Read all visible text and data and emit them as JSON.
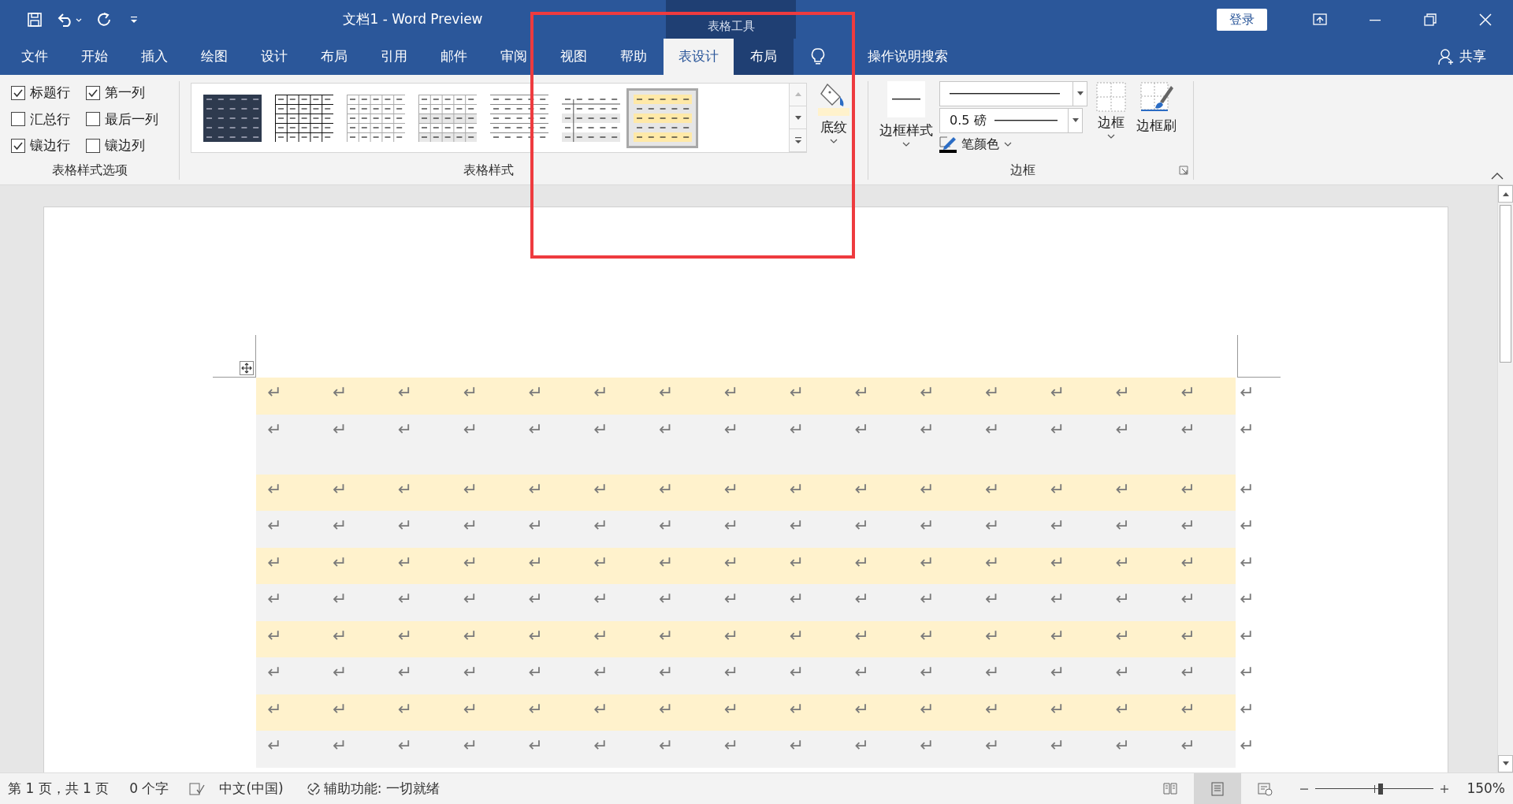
{
  "window": {
    "title": "文档1  -  Word Preview",
    "context_label": "表格工具",
    "sign_in": "登录"
  },
  "ribbon_tabs": [
    {
      "label": "文件",
      "selected": false,
      "contextual": false
    },
    {
      "label": "开始",
      "selected": false,
      "contextual": false
    },
    {
      "label": "插入",
      "selected": false,
      "contextual": false
    },
    {
      "label": "绘图",
      "selected": false,
      "contextual": false
    },
    {
      "label": "设计",
      "selected": false,
      "contextual": false
    },
    {
      "label": "布局",
      "selected": false,
      "contextual": false
    },
    {
      "label": "引用",
      "selected": false,
      "contextual": false
    },
    {
      "label": "邮件",
      "selected": false,
      "contextual": false
    },
    {
      "label": "审阅",
      "selected": false,
      "contextual": false
    },
    {
      "label": "视图",
      "selected": false,
      "contextual": false
    },
    {
      "label": "帮助",
      "selected": false,
      "contextual": false
    },
    {
      "label": "表设计",
      "selected": true,
      "contextual": true
    },
    {
      "label": "布局",
      "selected": false,
      "contextual": true
    }
  ],
  "tell_me": "操作说明搜索",
  "share": "共享",
  "style_options": {
    "title": "表格样式选项",
    "items": [
      {
        "label": "标题行",
        "checked": true
      },
      {
        "label": "第一列",
        "checked": true
      },
      {
        "label": "汇总行",
        "checked": false
      },
      {
        "label": "最后一列",
        "checked": false
      },
      {
        "label": "镶边行",
        "checked": true
      },
      {
        "label": "镶边列",
        "checked": false
      }
    ]
  },
  "table_styles": {
    "title": "表格样式",
    "gallery": [
      {
        "kind": "dark",
        "selected": false
      },
      {
        "kind": "grid",
        "selected": false
      },
      {
        "kind": "light-grid",
        "selected": false
      },
      {
        "kind": "banded-grid",
        "selected": false
      },
      {
        "kind": "lines",
        "selected": false
      },
      {
        "kind": "first-column",
        "selected": false
      },
      {
        "kind": "banded-yellow",
        "selected": true
      }
    ]
  },
  "shading": {
    "label": "底纹"
  },
  "borders": {
    "title": "边框",
    "border_styles": "边框样式",
    "weight": "0.5 磅",
    "pen_color": "笔颜色",
    "borders": "边框",
    "border_painter": "边框刷"
  },
  "document": {
    "rows": [
      {
        "shaded": true,
        "tall": false,
        "cells": [
          "↵",
          "↵",
          "↵",
          "↵",
          "↵",
          "↵",
          "↵",
          "↵",
          "↵",
          "↵",
          "↵",
          "↵",
          "↵",
          "↵",
          "↵"
        ],
        "end_mark": "↵"
      },
      {
        "shaded": false,
        "tall": true,
        "cells": [
          "↵",
          "↵",
          "↵",
          "↵",
          "↵",
          "↵",
          "↵",
          "↵",
          "↵",
          "↵",
          "↵",
          "↵",
          "↵",
          "↵",
          "↵"
        ],
        "end_mark": "↵"
      },
      {
        "shaded": true,
        "tall": false,
        "cells": [
          "↵",
          "↵",
          "↵",
          "↵",
          "↵",
          "↵",
          "↵",
          "↵",
          "↵",
          "↵",
          "↵",
          "↵",
          "↵",
          "↵",
          "↵"
        ],
        "end_mark": "↵"
      },
      {
        "shaded": false,
        "tall": false,
        "cells": [
          "↵",
          "↵",
          "↵",
          "↵",
          "↵",
          "↵",
          "↵",
          "↵",
          "↵",
          "↵",
          "↵",
          "↵",
          "↵",
          "↵",
          "↵"
        ],
        "end_mark": "↵"
      },
      {
        "shaded": true,
        "tall": false,
        "cells": [
          "↵",
          "↵",
          "↵",
          "↵",
          "↵",
          "↵",
          "↵",
          "↵",
          "↵",
          "↵",
          "↵",
          "↵",
          "↵",
          "↵",
          "↵"
        ],
        "end_mark": "↵"
      },
      {
        "shaded": false,
        "tall": false,
        "cells": [
          "↵",
          "↵",
          "↵",
          "↵",
          "↵",
          "↵",
          "↵",
          "↵",
          "↵",
          "↵",
          "↵",
          "↵",
          "↵",
          "↵",
          "↵"
        ],
        "end_mark": "↵"
      },
      {
        "shaded": true,
        "tall": false,
        "cells": [
          "↵",
          "↵",
          "↵",
          "↵",
          "↵",
          "↵",
          "↵",
          "↵",
          "↵",
          "↵",
          "↵",
          "↵",
          "↵",
          "↵",
          "↵"
        ],
        "end_mark": "↵"
      },
      {
        "shaded": false,
        "tall": false,
        "cells": [
          "↵",
          "↵",
          "↵",
          "↵",
          "↵",
          "↵",
          "↵",
          "↵",
          "↵",
          "↵",
          "↵",
          "↵",
          "↵",
          "↵",
          "↵"
        ],
        "end_mark": "↵"
      },
      {
        "shaded": true,
        "tall": false,
        "cells": [
          "↵",
          "↵",
          "↵",
          "↵",
          "↵",
          "↵",
          "↵",
          "↵",
          "↵",
          "↵",
          "↵",
          "↵",
          "↵",
          "↵",
          "↵"
        ],
        "end_mark": "↵"
      },
      {
        "shaded": false,
        "tall": false,
        "cells": [
          "↵",
          "↵",
          "↵",
          "↵",
          "↵",
          "↵",
          "↵",
          "↵",
          "↵",
          "↵",
          "↵",
          "↵",
          "↵",
          "↵",
          "↵"
        ],
        "end_mark": "↵"
      }
    ]
  },
  "status_bar": {
    "page": "第 1 页，共 1 页",
    "words": "0 个字",
    "language": "中文(中国)",
    "accessibility": "辅助功能: 一切就绪",
    "zoom_slider": {
      "level": 0.55
    },
    "zoom": "150%"
  }
}
